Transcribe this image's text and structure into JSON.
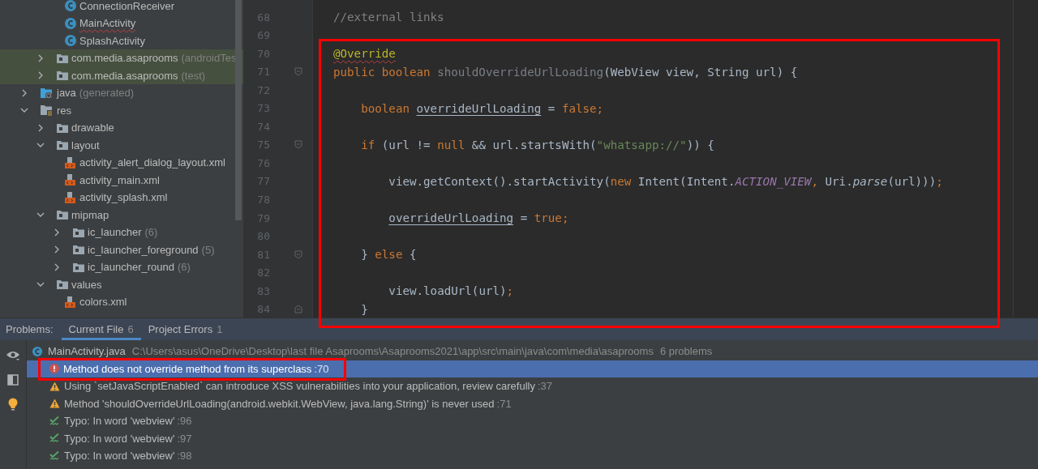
{
  "project_tree": {
    "items": [
      {
        "children": [
          {
            "children": [
              {
                "label": "ConnectionReceiver",
                "kind": "class",
                "error": false
              },
              {
                "label": "MainActivity",
                "kind": "class",
                "error": true
              },
              {
                "label": "SplashActivity",
                "kind": "class",
                "error": false
              }
            ]
          },
          {
            "label": "com.media.asaprooms",
            "note": "(androidTes",
            "kind": "folder",
            "expanded": false,
            "highlighted": true
          },
          {
            "label": "com.media.asaprooms",
            "note": "(test)",
            "kind": "folder",
            "expanded": false,
            "highlighted": true
          }
        ]
      },
      {
        "label": "java",
        "note": "(generated)",
        "kind": "generated",
        "expanded": false,
        "highlighted": false
      },
      {
        "label": "res",
        "kind": "resources",
        "expanded": true,
        "highlighted": false,
        "children": [
          {
            "label": "drawable",
            "kind": "folder",
            "expanded": false,
            "highlighted": false
          },
          {
            "label": "layout",
            "kind": "folder",
            "expanded": true,
            "highlighted": false,
            "children": [
              {
                "label": "activity_alert_dialog_layout.xml",
                "kind": "xml",
                "error": false
              },
              {
                "label": "activity_main.xml",
                "kind": "xml",
                "error": false
              },
              {
                "label": "activity_splash.xml",
                "kind": "xml",
                "error": false
              }
            ]
          },
          {
            "label": "mipmap",
            "kind": "folder",
            "expanded": true,
            "highlighted": false,
            "children": [
              {
                "label": "ic_launcher",
                "note": "(6)",
                "kind": "folder",
                "expanded": false,
                "highlighted": false
              },
              {
                "label": "ic_launcher_foreground",
                "note": "(5)",
                "kind": "folder",
                "expanded": false,
                "highlighted": false
              },
              {
                "label": "ic_launcher_round",
                "note": "(6)",
                "kind": "folder",
                "expanded": false,
                "highlighted": false
              }
            ]
          },
          {
            "label": "values",
            "kind": "folder",
            "expanded": true,
            "highlighted": false,
            "children": [
              {
                "label": "colors.xml",
                "kind": "xml",
                "error": false
              }
            ]
          }
        ]
      }
    ]
  },
  "editor": {
    "highlighted": true,
    "lines": [
      {
        "number": "68",
        "kind": "plain",
        "tokens": [
          {
            "text": "//external links",
            "kind": "comment"
          }
        ]
      },
      {
        "number": "69",
        "kind": "plain"
      },
      {
        "number": "70",
        "kind": "plain",
        "tokens": [
          {
            "text": "@Override",
            "kind": "annotation-error"
          }
        ]
      },
      {
        "number": "71",
        "kind": "fold-start",
        "tokens": [
          {
            "text": "public boolean ",
            "kind": "keyword"
          },
          {
            "text": "shouldOverrideUrlLoading",
            "kind": "unused"
          },
          {
            "text": "(WebView view, String url) {",
            "kind": "plain"
          }
        ]
      },
      {
        "number": "72",
        "kind": "plain"
      },
      {
        "number": "73",
        "kind": "plain",
        "tokens": [
          {
            "text": "    boolean ",
            "kind": "keyword"
          },
          {
            "text": "overrideUrlLoading",
            "kind": "variable"
          },
          {
            "text": " = ",
            "kind": "plain"
          },
          {
            "text": "false;",
            "kind": "keyword"
          }
        ]
      },
      {
        "number": "74",
        "kind": "plain"
      },
      {
        "number": "75",
        "kind": "fold-start",
        "tokens": [
          {
            "text": "    if ",
            "kind": "keyword"
          },
          {
            "text": "(url != ",
            "kind": "plain"
          },
          {
            "text": "null ",
            "kind": "keyword"
          },
          {
            "text": "&& url.startsWith(",
            "kind": "plain"
          },
          {
            "text": "\"whatsapp://\"",
            "kind": "string"
          },
          {
            "text": ")) {",
            "kind": "plain"
          }
        ]
      },
      {
        "number": "76",
        "kind": "plain"
      },
      {
        "number": "77",
        "kind": "plain",
        "tokens": [
          {
            "text": "        view.getContext().startActivity(",
            "kind": "plain"
          },
          {
            "text": "new ",
            "kind": "keyword"
          },
          {
            "text": "Intent(Intent.",
            "kind": "plain"
          },
          {
            "text": "ACTION_VIEW",
            "kind": "constant"
          },
          {
            "text": ", ",
            "kind": "keyword"
          },
          {
            "text": "Uri.",
            "kind": "plain"
          },
          {
            "text": "parse",
            "kind": "static"
          },
          {
            "text": "(url)))",
            "kind": "plain"
          },
          {
            "text": ";",
            "kind": "keyword"
          }
        ]
      },
      {
        "number": "78",
        "kind": "plain"
      },
      {
        "number": "79",
        "kind": "plain",
        "tokens": [
          {
            "text": "        overrideUrlLoading",
            "kind": "variable"
          },
          {
            "text": " = ",
            "kind": "plain"
          },
          {
            "text": "true;",
            "kind": "keyword"
          }
        ]
      },
      {
        "number": "80",
        "kind": "plain"
      },
      {
        "number": "81",
        "kind": "fold-start",
        "tokens": [
          {
            "text": "    } ",
            "kind": "plain"
          },
          {
            "text": "else ",
            "kind": "keyword"
          },
          {
            "text": "{",
            "kind": "plain"
          }
        ]
      },
      {
        "number": "82",
        "kind": "plain"
      },
      {
        "number": "83",
        "kind": "plain",
        "tokens": [
          {
            "text": "        view.loadUrl(url)",
            "kind": "plain"
          },
          {
            "text": ";",
            "kind": "keyword"
          }
        ]
      },
      {
        "number": "84",
        "kind": "fold-end",
        "tokens": [
          {
            "text": "    }",
            "kind": "plain"
          }
        ]
      }
    ]
  },
  "problems": {
    "title": "Problems:",
    "tabs": [
      {
        "label": "Current File",
        "count": "6",
        "selected": true
      },
      {
        "label": "Project Errors",
        "count": "1",
        "selected": false
      }
    ],
    "file": {
      "name": "MainActivity.java",
      "path": "C:\\Users\\asus\\OneDrive\\Desktop\\last file Asaprooms\\Asaprooms2021\\app\\src\\main\\java\\com\\media\\asaprooms",
      "count": "6 problems"
    },
    "items": [
      {
        "kind": "error",
        "text": "Method does not override method from its superclass",
        "line": ":70",
        "selected": true,
        "highlighted": true
      },
      {
        "kind": "warning",
        "text": "Using `setJavaScriptEnabled` can introduce XSS vulnerabilities into your application, review carefully",
        "line": ":37",
        "selected": false,
        "highlighted": false
      },
      {
        "kind": "warning",
        "text": "Method 'shouldOverrideUrlLoading(android.webkit.WebView, java.lang.String)' is never used",
        "line": ":71",
        "selected": false,
        "highlighted": false
      },
      {
        "kind": "typo",
        "text": "Typo: In word 'webview'",
        "line": ":96",
        "selected": false,
        "highlighted": false
      },
      {
        "kind": "typo",
        "text": "Typo: In word 'webview'",
        "line": ":97",
        "selected": false,
        "highlighted": false
      },
      {
        "kind": "typo",
        "text": "Typo: In word 'webview'",
        "line": ":98",
        "selected": false,
        "highlighted": false
      }
    ]
  }
}
